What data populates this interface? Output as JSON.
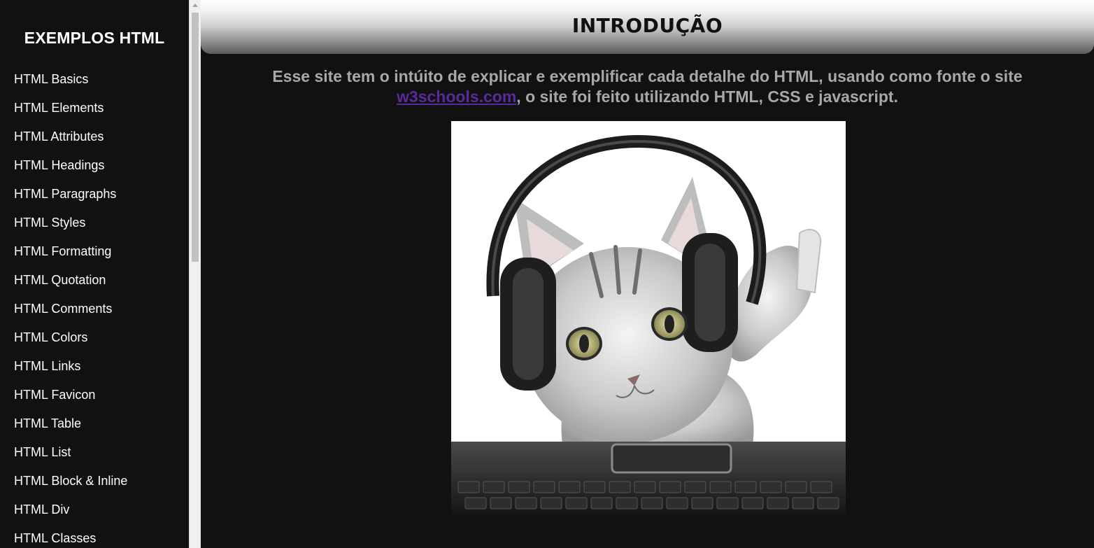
{
  "sidebar": {
    "title": "EXEMPLOS HTML",
    "items": [
      {
        "label": "HTML Basics"
      },
      {
        "label": "HTML Elements"
      },
      {
        "label": "HTML Attributes"
      },
      {
        "label": "HTML Headings"
      },
      {
        "label": "HTML Paragraphs"
      },
      {
        "label": "HTML Styles"
      },
      {
        "label": "HTML Formatting"
      },
      {
        "label": "HTML Quotation"
      },
      {
        "label": "HTML Comments"
      },
      {
        "label": "HTML Colors"
      },
      {
        "label": "HTML Links"
      },
      {
        "label": "HTML Favicon"
      },
      {
        "label": "HTML Table"
      },
      {
        "label": "HTML List"
      },
      {
        "label": "HTML Block & Inline"
      },
      {
        "label": "HTML Div"
      },
      {
        "label": "HTML Classes"
      }
    ]
  },
  "main": {
    "title": "INTRODUÇÃO",
    "intro_before_link": "Esse site tem o intúito de explicar e exemplificar cada detalhe do HTML, usando como fonte o site ",
    "link_text": "w3schools.com",
    "intro_after_link": ", o site foi feito utilizando HTML, CSS e javascript.",
    "image_icon": "cat-with-headphones-icon"
  },
  "colors": {
    "background": "#111111",
    "sidebar_text": "#ffffff",
    "intro_text": "#a8a8a8",
    "link": "#5a2a9c"
  }
}
